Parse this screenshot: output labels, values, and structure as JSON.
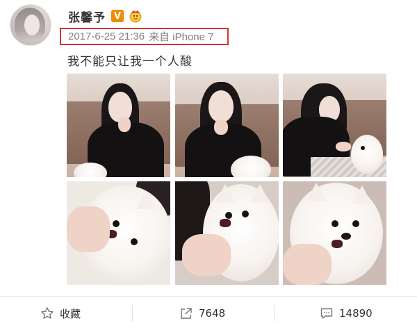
{
  "post": {
    "user_name": "张馨予",
    "verified_badge": "V",
    "timestamp": "2017-6-25 21:36",
    "source": "来自 iPhone 7",
    "text": "我不能只让我一个人酸",
    "highlight_color": "#e02b2b",
    "verified_color": "#f08c00"
  },
  "photos": [
    {
      "name": "photo-1",
      "icon": "woman-eating-photo"
    },
    {
      "name": "photo-2",
      "icon": "woman-eating-photo"
    },
    {
      "name": "photo-3",
      "icon": "woman-feeding-dog-photo"
    },
    {
      "name": "photo-4",
      "icon": "dog-eating-photo"
    },
    {
      "name": "photo-5",
      "icon": "dog-eating-photo"
    },
    {
      "name": "photo-6",
      "icon": "dog-eating-photo"
    }
  ],
  "actions": {
    "favorite_label": "收藏",
    "repost_count": "7648",
    "comment_count": "14890"
  }
}
